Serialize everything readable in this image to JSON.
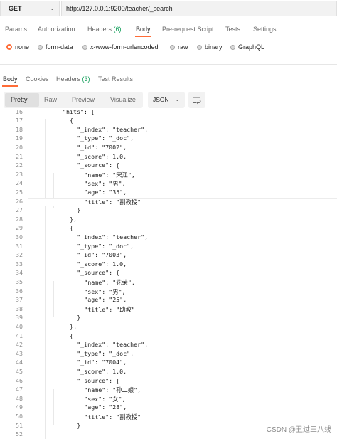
{
  "request": {
    "method": "GET",
    "url": "http://127.0.0.1:9200/teacher/_search"
  },
  "request_tabs": {
    "params": "Params",
    "authorization": "Authorization",
    "headers": "Headers",
    "headers_count": "(6)",
    "body": "Body",
    "pre_request": "Pre-request Script",
    "tests": "Tests",
    "settings": "Settings"
  },
  "body_types": {
    "none": "none",
    "form_data": "form-data",
    "urlencoded": "x-www-form-urlencoded",
    "raw": "raw",
    "binary": "binary",
    "graphql": "GraphQL",
    "selected": "none"
  },
  "response_tabs": {
    "body": "Body",
    "cookies": "Cookies",
    "headers": "Headers",
    "headers_count": "(3)",
    "test_results": "Test Results"
  },
  "view_modes": {
    "pretty": "Pretty",
    "raw": "Raw",
    "preview": "Preview",
    "visualize": "Visualize"
  },
  "format": "JSON",
  "response_lines": [
    {
      "n": "16",
      "t": "\"hits\": ["
    },
    {
      "n": "17",
      "t": "{"
    },
    {
      "n": "18",
      "t": "\"_index\": \"teacher\","
    },
    {
      "n": "19",
      "t": "\"_type\": \"_doc\","
    },
    {
      "n": "20",
      "t": "\"_id\": \"7002\","
    },
    {
      "n": "21",
      "t": "\"_score\": 1.0,"
    },
    {
      "n": "22",
      "t": "\"_source\": {"
    },
    {
      "n": "23",
      "t": "\"name\": \"宋江\","
    },
    {
      "n": "24",
      "t": "\"sex\": \"男\","
    },
    {
      "n": "25",
      "t": "\"age\": \"35\","
    },
    {
      "n": "26",
      "t": "\"title\": \"副教授\""
    },
    {
      "n": "27",
      "t": "}"
    },
    {
      "n": "28",
      "t": "},"
    },
    {
      "n": "29",
      "t": "{"
    },
    {
      "n": "30",
      "t": "\"_index\": \"teacher\","
    },
    {
      "n": "31",
      "t": "\"_type\": \"_doc\","
    },
    {
      "n": "32",
      "t": "\"_id\": \"7003\","
    },
    {
      "n": "33",
      "t": "\"_score\": 1.0,"
    },
    {
      "n": "34",
      "t": "\"_source\": {"
    },
    {
      "n": "35",
      "t": "\"name\": \"花荣\","
    },
    {
      "n": "36",
      "t": "\"sex\": \"男\","
    },
    {
      "n": "37",
      "t": "\"age\": \"25\","
    },
    {
      "n": "38",
      "t": "\"title\": \"助教\""
    },
    {
      "n": "39",
      "t": "}"
    },
    {
      "n": "40",
      "t": "},"
    },
    {
      "n": "41",
      "t": "{"
    },
    {
      "n": "42",
      "t": "\"_index\": \"teacher\","
    },
    {
      "n": "43",
      "t": "\"_type\": \"_doc\","
    },
    {
      "n": "44",
      "t": "\"_id\": \"7004\","
    },
    {
      "n": "45",
      "t": "\"_score\": 1.0,"
    },
    {
      "n": "46",
      "t": "\"_source\": {"
    },
    {
      "n": "47",
      "t": "\"name\": \"孙二娘\","
    },
    {
      "n": "48",
      "t": "\"sex\": \"女\","
    },
    {
      "n": "49",
      "t": "\"age\": \"28\","
    },
    {
      "n": "50",
      "t": "\"title\": \"副教授\""
    },
    {
      "n": "51",
      "t": "}"
    },
    {
      "n": "52",
      "t": ""
    }
  ],
  "watermark": "CSDN @丑过三八线",
  "colors": {
    "accent": "#ff6c37",
    "count_green": "#0f9d58"
  }
}
